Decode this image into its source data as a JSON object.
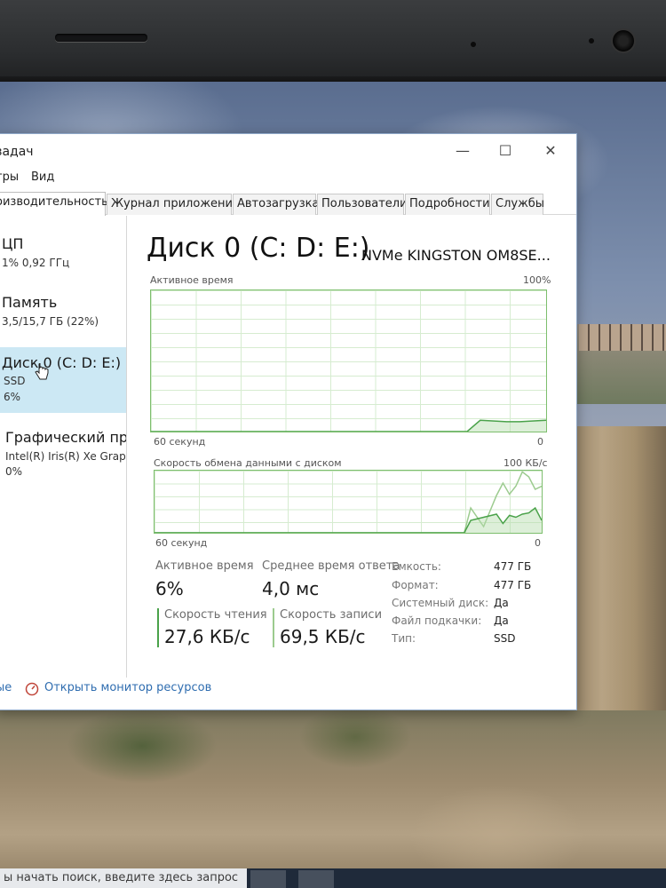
{
  "window": {
    "title": "задач",
    "controls": {
      "minimize": "—",
      "maximize": "☐",
      "close": "✕"
    }
  },
  "menu": {
    "items": [
      "тры",
      "Вид"
    ]
  },
  "tabs": [
    {
      "label": "оизводительность",
      "active": true
    },
    {
      "label": "Журнал приложений",
      "active": false
    },
    {
      "label": "Автозагрузка",
      "active": false
    },
    {
      "label": "Пользователи",
      "active": false
    },
    {
      "label": "Подробности",
      "active": false
    },
    {
      "label": "Службы",
      "active": false
    }
  ],
  "sidebar": {
    "items": [
      {
        "name": "ЦП",
        "line1": "1% 0,92 ГГц",
        "line2": ""
      },
      {
        "name": "Память",
        "line1": "3,5/15,7 ГБ (22%)",
        "line2": ""
      },
      {
        "name": "Диск 0 (C: D: E:)",
        "line1": "SSD",
        "line2": "6%"
      },
      {
        "name": "Графический про",
        "line1": "Intel(R) Iris(R) Xe Graph",
        "line2": "0%"
      }
    ]
  },
  "detail": {
    "title": "Диск 0 (C: D: E:)",
    "model": "NVMe KINGSTON OM8SE...",
    "active_time_graph": {
      "label": "Активное время",
      "max_label": "100%",
      "x_left": "60 секунд",
      "x_right": "0"
    },
    "transfer_graph": {
      "label": "Скорость обмена данными с диском",
      "max_label": "100 КБ/с",
      "x_left": "60 секунд",
      "x_right": "0"
    },
    "stats": {
      "active_time_label": "Активное время",
      "active_time_value": "6%",
      "response_label": "Среднее время ответа",
      "response_value": "4,0 мс",
      "read_label": "Скорость чтения",
      "read_value": "27,6 КБ/с",
      "write_label": "Скорость записи",
      "write_value": "69,5 КБ/с"
    },
    "properties": [
      {
        "label": "Емкость:",
        "value": "477 ГБ"
      },
      {
        "label": "Формат:",
        "value": "477 ГБ"
      },
      {
        "label": "Системный диск:",
        "value": "Да"
      },
      {
        "label": "Файл подкачки:",
        "value": "Да"
      },
      {
        "label": "Тип:",
        "value": "SSD"
      }
    ]
  },
  "footer": {
    "left_text": "ые",
    "monitor_link": "Открыть монитор ресурсов"
  },
  "taskbar": {
    "search_text": "ы начать поиск, введите здесь запрос"
  },
  "colors": {
    "graph_border": "#7dbe6d",
    "active_line": "#4aa24a",
    "read_color": "#4aa24a",
    "write_color": "#9ccb8f",
    "selected_bg": "#cce8f4",
    "link": "#2f6db0"
  },
  "chart_data": [
    {
      "type": "area",
      "title": "Активное время",
      "ylim": [
        0,
        100
      ],
      "x": [
        60,
        12,
        10,
        6,
        4,
        0
      ],
      "values": [
        0,
        0,
        8,
        7,
        7,
        8
      ]
    },
    {
      "type": "line",
      "title": "Скорость обмена данными с диском",
      "ylim": [
        0,
        100
      ],
      "x": [
        60,
        12,
        11,
        9,
        7,
        6,
        5,
        4,
        3,
        2,
        1,
        0
      ],
      "series": [
        {
          "values": [
            0,
            0,
            20,
            25,
            30,
            15,
            28,
            25,
            30,
            32,
            40,
            20
          ]
        },
        {
          "values": [
            0,
            0,
            40,
            10,
            60,
            80,
            62,
            75,
            98,
            90,
            70,
            75
          ]
        }
      ]
    }
  ]
}
